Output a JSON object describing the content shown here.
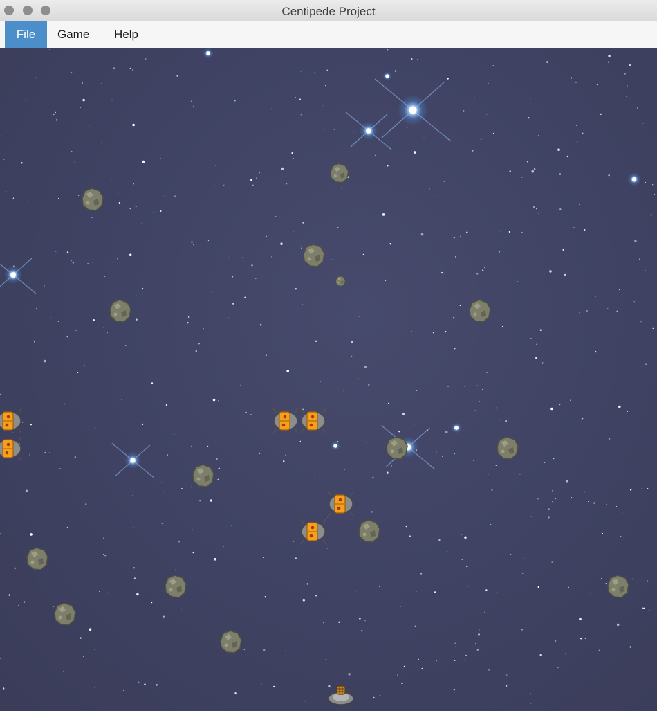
{
  "window": {
    "title": "Centipede Project"
  },
  "menubar": {
    "items": [
      {
        "label": "File",
        "active": true
      },
      {
        "label": "Game",
        "active": false
      },
      {
        "label": "Help",
        "active": false
      }
    ]
  },
  "game": {
    "background_color": "#3f4260",
    "mushroom_color": "#7d7f6a",
    "centipede_color": "#f2a11c",
    "player_color": "#8c8c8c"
  }
}
